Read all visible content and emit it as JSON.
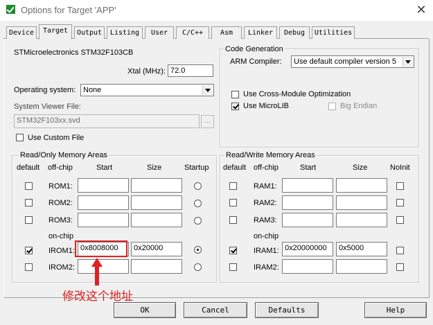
{
  "window": {
    "title": "Options for Target 'APP'",
    "close_glyph": "✕",
    "icon": "check-icon",
    "icon_color": "#1e8a2e"
  },
  "tabs": [
    {
      "label": "Device",
      "active": false
    },
    {
      "label": "Target",
      "active": true
    },
    {
      "label": "Output",
      "active": false
    },
    {
      "label": "Listing",
      "active": false
    },
    {
      "label": "User",
      "active": false
    },
    {
      "label": "C/C++",
      "active": false
    },
    {
      "label": "Asm",
      "active": false
    },
    {
      "label": "Linker",
      "active": false
    },
    {
      "label": "Debug",
      "active": false
    },
    {
      "label": "Utilities",
      "active": false
    }
  ],
  "device": {
    "name": "STMicroelectronics STM32F103CB",
    "xtal_label": "Xtal (MHz):",
    "xtal_value": "72.0",
    "os_label": "Operating system:",
    "os_value": "None",
    "svd_label": "System Viewer File:",
    "svd_value": "STM32F103xx.svd",
    "browse_label": "...",
    "custom_file_label": "Use Custom File",
    "custom_file_checked": false
  },
  "codegen": {
    "title": "Code Generation",
    "compiler_label": "ARM Compiler:",
    "compiler_value": "Use default compiler version 5",
    "cross_module_label": "Use Cross-Module Optimization",
    "cross_module_checked": false,
    "microlib_label": "Use MicroLIB",
    "microlib_checked": true,
    "big_endian_label": "Big Endian",
    "big_endian_checked": false
  },
  "rom": {
    "title": "Read/Only Memory Areas",
    "headers": {
      "default": "default",
      "offchip": "off-chip",
      "start": "Start",
      "size": "Size",
      "startup": "Startup"
    },
    "onchip_label": "on-chip",
    "rows": [
      {
        "label": "ROM1:",
        "default": false,
        "start": "",
        "size": "",
        "startup": false
      },
      {
        "label": "ROM2:",
        "default": false,
        "start": "",
        "size": "",
        "startup": false
      },
      {
        "label": "ROM3:",
        "default": false,
        "start": "",
        "size": "",
        "startup": false
      },
      {
        "label": "IROM1:",
        "default": true,
        "start": "0x8008000",
        "size": "0x20000",
        "startup": true
      },
      {
        "label": "IROM2:",
        "default": false,
        "start": "",
        "size": "",
        "startup": false
      }
    ]
  },
  "ram": {
    "title": "Read/Write Memory Areas",
    "headers": {
      "default": "default",
      "offchip": "off-chip",
      "start": "Start",
      "size": "Size",
      "noinit": "NoInit"
    },
    "onchip_label": "on-chip",
    "rows": [
      {
        "label": "RAM1:",
        "default": false,
        "start": "",
        "size": "",
        "noinit": false
      },
      {
        "label": "RAM2:",
        "default": false,
        "start": "",
        "size": "",
        "noinit": false
      },
      {
        "label": "RAM3:",
        "default": false,
        "start": "",
        "size": "",
        "noinit": false
      },
      {
        "label": "IRAM1:",
        "default": true,
        "start": "0x20000000",
        "size": "0x5000",
        "noinit": false
      },
      {
        "label": "IRAM2:",
        "default": false,
        "start": "",
        "size": "",
        "noinit": false
      }
    ]
  },
  "buttons": {
    "ok": "OK",
    "cancel": "Cancel",
    "defaults": "Defaults",
    "help": "Help"
  },
  "annotation": {
    "text": "修改这个地址",
    "color": "#e02020"
  }
}
